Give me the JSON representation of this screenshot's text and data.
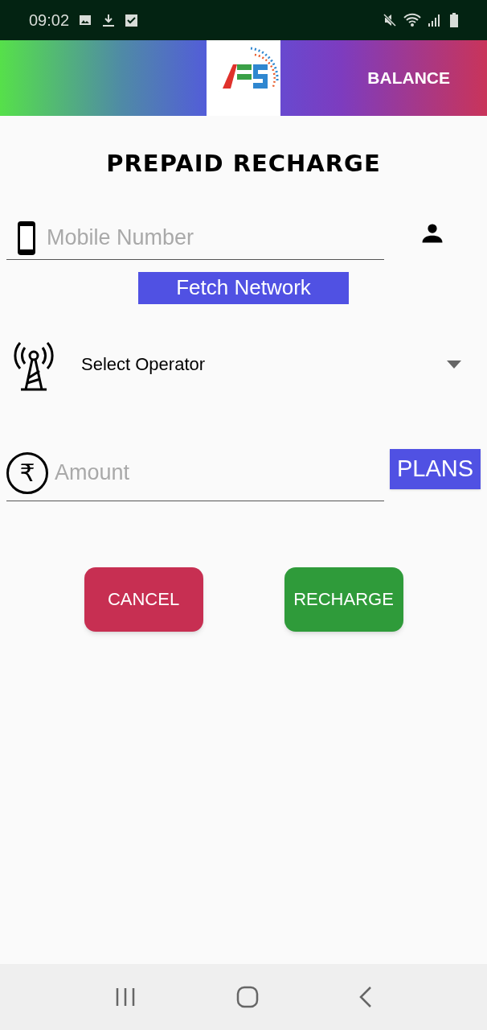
{
  "status_bar": {
    "time": "09:02"
  },
  "header": {
    "balance_label": "BALANCE"
  },
  "title": "PREPAID RECHARGE",
  "mobile_field": {
    "placeholder": "Mobile Number"
  },
  "fetch_button": "Fetch Network",
  "operator_select": {
    "value": "Select Operator"
  },
  "amount_field": {
    "currency_symbol": "₹",
    "placeholder": "Amount"
  },
  "plans_button": "PLANS",
  "actions": [
    {
      "label": "CANCEL",
      "kind": "cancel"
    },
    {
      "label": "RECHARGE",
      "kind": "confirm"
    }
  ]
}
